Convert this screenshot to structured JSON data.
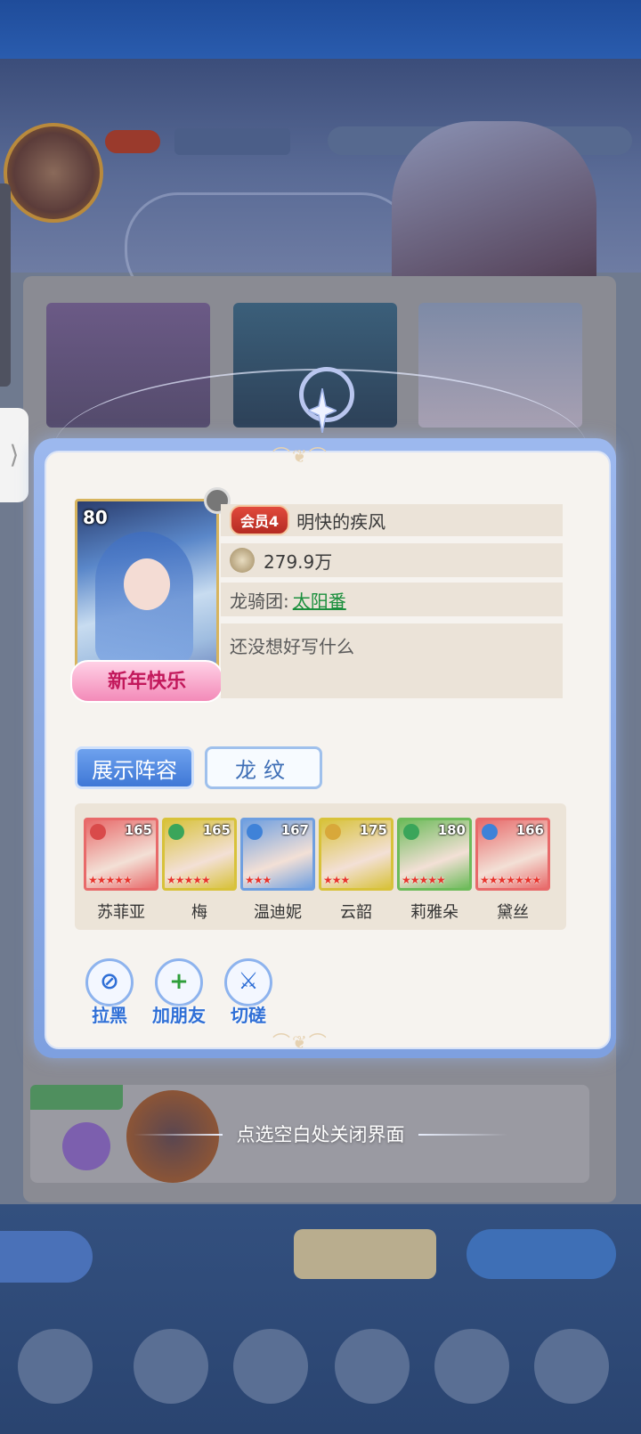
{
  "profile": {
    "level": "80",
    "portrait_banner": "新年快乐",
    "vip_badge": "会员4",
    "name": "明快的疾风",
    "power": "279.9万",
    "guild_label": "龙骑团:",
    "guild_name": "太阳番",
    "signature": "还没想好写什么"
  },
  "tabs": [
    {
      "label": "展示阵容",
      "active": true
    },
    {
      "label": "龙纹",
      "active": false
    }
  ],
  "lineup": [
    {
      "name": "苏菲亚",
      "level": "165",
      "stars": 5,
      "type_icon": "attack-icon",
      "color": "#e86a6a"
    },
    {
      "name": "梅",
      "level": "165",
      "stars": 5,
      "type_icon": "wind-icon",
      "color": "#d8c23a"
    },
    {
      "name": "温迪妮",
      "level": "167",
      "stars": 3,
      "type_icon": "water-icon",
      "color": "#6f9fe0"
    },
    {
      "name": "云韶",
      "level": "175",
      "stars": 3,
      "type_icon": "light-icon",
      "color": "#d8c23a"
    },
    {
      "name": "莉雅朵",
      "level": "180",
      "stars": 5,
      "type_icon": "wind-icon",
      "color": "#6dbb5a"
    },
    {
      "name": "黛丝",
      "level": "166",
      "stars": 7,
      "type_icon": "water-icon",
      "color": "#e86a6a"
    }
  ],
  "actions": [
    {
      "label": "拉黑",
      "icon": "block-user-icon"
    },
    {
      "label": "加朋友",
      "icon": "add-friend-icon"
    },
    {
      "label": "切磋",
      "icon": "crossed-swords-icon"
    }
  ],
  "close_hint": "点选空白处关闭界面",
  "colors": {
    "accent_blue": "#3f78d6",
    "guild_green": "#1b8f3d",
    "vip_red": "#c9352a",
    "star_red": "#e8342c"
  }
}
